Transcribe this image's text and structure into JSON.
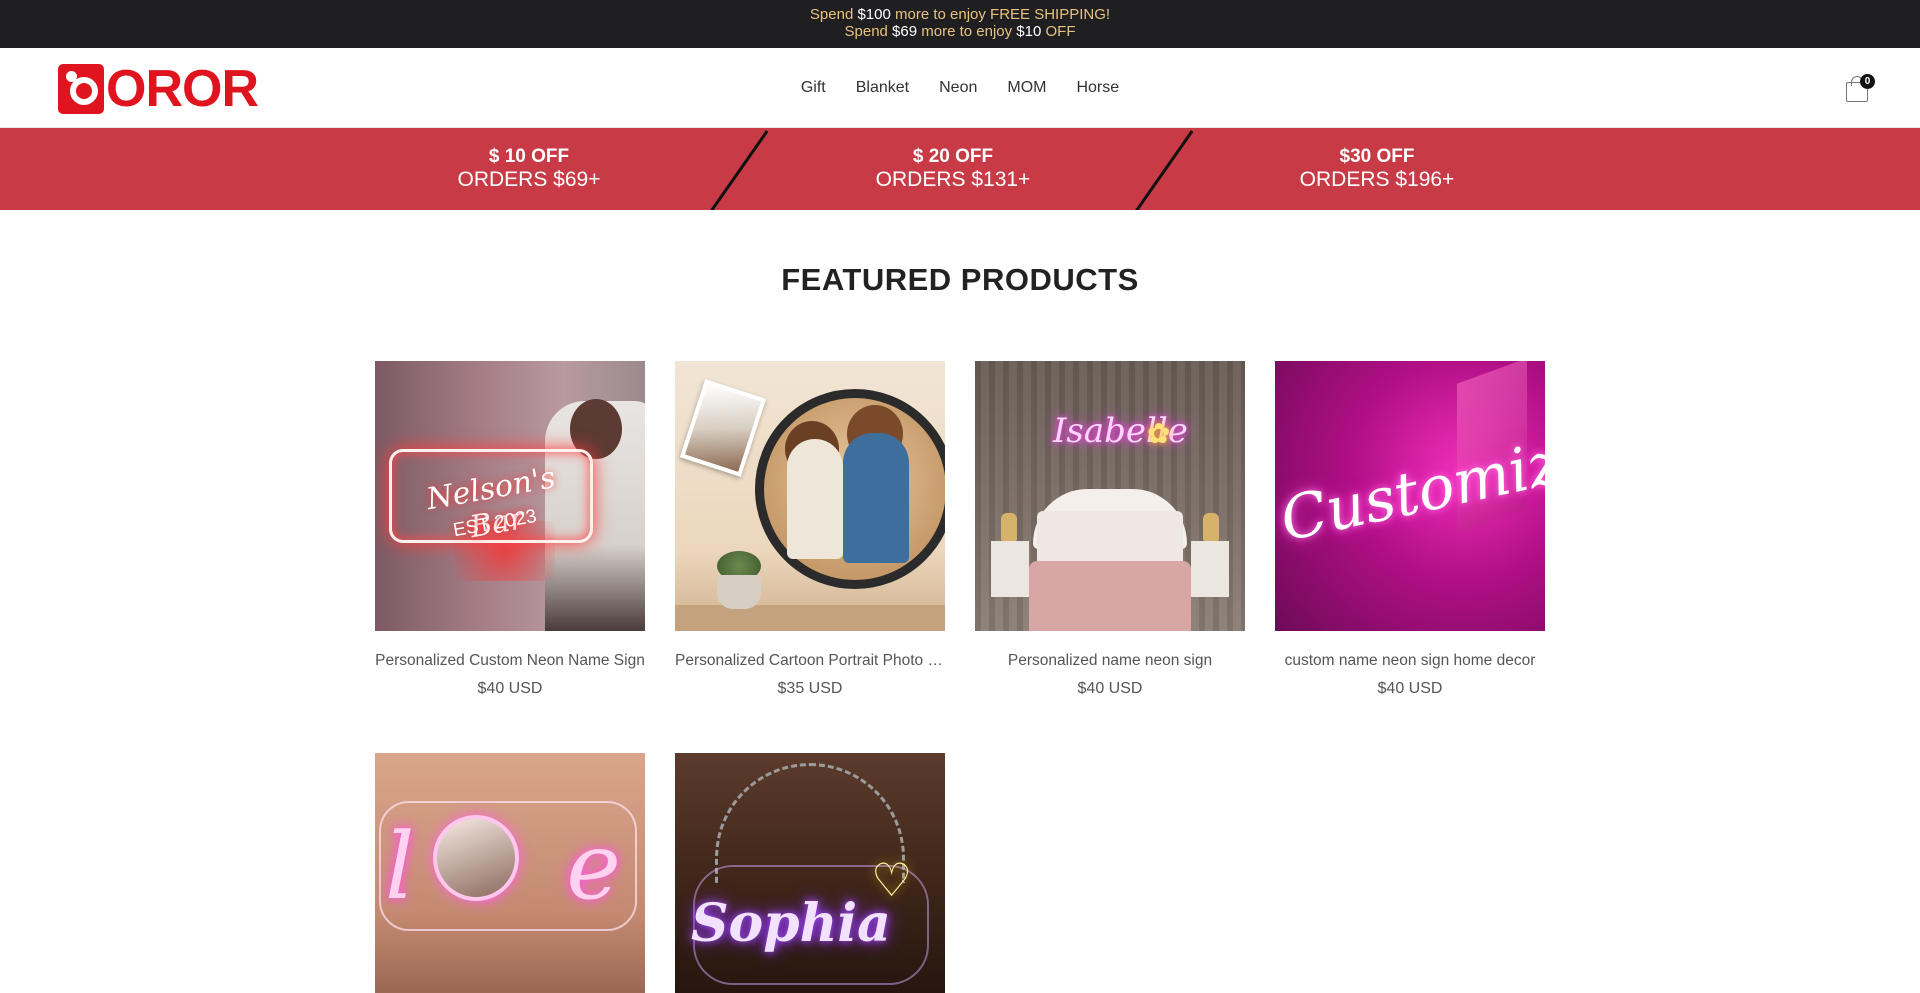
{
  "announcement": {
    "line1": {
      "pre": "Spend ",
      "amount": "$100",
      "post": " more to enjoy FREE SHIPPING!"
    },
    "line2": {
      "pre": "Spend ",
      "amount": "$69",
      "mid": " more to enjoy ",
      "amount2": "$10",
      "post": " OFF"
    }
  },
  "header": {
    "logo_text": "OROR",
    "nav": [
      "Gift",
      "Blanket",
      "Neon",
      "MOM",
      "Horse"
    ],
    "cart_count": "0"
  },
  "promo": [
    {
      "line1": "$ 10 OFF",
      "line2": "ORDERS $69+"
    },
    {
      "line1": "$ 20 OFF",
      "line2": "ORDERS $131+"
    },
    {
      "line1": "$30 OFF",
      "line2": "ORDERS $196+"
    }
  ],
  "featured": {
    "title": "FEATURED PRODUCTS",
    "products": [
      {
        "name": "Personalized Custom Neon Name Sign",
        "price": "$40 USD",
        "image_text": [
          "Nelson's Bar",
          "EST 2023"
        ]
      },
      {
        "name": "Personalized Cartoon Portrait Photo Mirror",
        "price": "$35 USD"
      },
      {
        "name": "Personalized name neon sign",
        "price": "$40 USD",
        "image_text": [
          "Isabelle"
        ]
      },
      {
        "name": "custom name neon sign home decor",
        "price": "$40 USD",
        "image_text": [
          "Customize"
        ]
      },
      {
        "name": "",
        "price": "",
        "image_text": [
          "l",
          "ve"
        ]
      },
      {
        "name": "",
        "price": "",
        "image_text": [
          "Sophia"
        ]
      }
    ]
  },
  "colors": {
    "announcement_bg": "#1f1f21",
    "announcement_text": "#e7c27f",
    "brand_red": "#e0141e",
    "promo_bg": "#c83b46"
  }
}
